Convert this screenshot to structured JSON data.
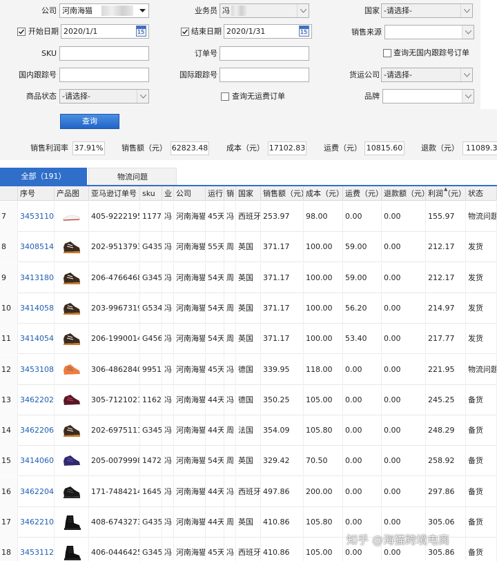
{
  "filters": {
    "company_label": "公司",
    "company_value": "河南海猫",
    "salesperson_label": "业务员",
    "salesperson_value": "冯",
    "country_label": "国家",
    "country_value": "-请选择-",
    "start_date_label": "开始日期",
    "start_date_value": "2020/1/1",
    "end_date_label": "结束日期",
    "end_date_value": "2020/1/31",
    "calendar_number": "15",
    "sales_source_label": "销售来源",
    "sales_source_value": "",
    "sku_label": "SKU",
    "sku_value": "",
    "order_no_label": "订单号",
    "order_no_value": "",
    "no_domestic_tracking_label": "查询无国内跟踪号订单",
    "domestic_tracking_label": "国内跟踪号",
    "domestic_tracking_value": "",
    "intl_tracking_label": "国际跟踪号",
    "intl_tracking_value": "",
    "freight_company_label": "货运公司",
    "freight_company_value": "-请选择-",
    "product_status_label": "商品状态",
    "product_status_value": "-请选择-",
    "no_freight_label": "查询无运费订单",
    "brand_label": "品牌",
    "brand_value": "",
    "query_button": "查询"
  },
  "stats": {
    "profit_rate_label": "销售利润率",
    "profit_rate_value": "37.91%",
    "sales_label": "销售额（元）",
    "sales_value": "62823.48",
    "cost_label": "成本（元）",
    "cost_value": "17102.83",
    "freight_label": "运费（元）",
    "freight_value": "10815.60",
    "refund_label": "退款（元）",
    "refund_value": "11089.39"
  },
  "tabs": [
    {
      "label": "全部（191）"
    },
    {
      "label": "物流问题"
    }
  ],
  "table": {
    "headers": [
      "序号",
      "产品图",
      "亚马逊订单号",
      "sku",
      "业",
      "公司",
      "运行",
      "销",
      "国家",
      "销售额（元）",
      "成本（元）",
      "运费（元）",
      "退款额（元）",
      "利润（元）",
      "状态"
    ],
    "rows": [
      {
        "row": "7",
        "no": "3453110",
        "shoe": "white",
        "order": "405-9222195-",
        "sku": "1177.",
        "biz": "冯",
        "company": "河南海猫",
        "run": "45天",
        "sales_ch": "冯",
        "country": "西班牙",
        "sales": "253.97",
        "cost": "98.00",
        "freight": "0.00",
        "refund": "0.00",
        "profit": "155.97",
        "status": "物流问题"
      },
      {
        "row": "8",
        "no": "3408514",
        "shoe": "brown",
        "order": "202-9513793-",
        "sku": "G435",
        "biz": "冯",
        "company": "河南海猫",
        "run": "55天",
        "sales_ch": "周",
        "country": "英国",
        "sales": "371.17",
        "cost": "100.00",
        "freight": "59.00",
        "refund": "0.00",
        "profit": "212.17",
        "status": "发货"
      },
      {
        "row": "9",
        "no": "3413180",
        "shoe": "brown",
        "order": "206-4766468-",
        "sku": "G345",
        "biz": "冯",
        "company": "河南海猫",
        "run": "54天",
        "sales_ch": "周",
        "country": "英国",
        "sales": "371.17",
        "cost": "100.00",
        "freight": "59.00",
        "refund": "0.00",
        "profit": "212.17",
        "status": "发货"
      },
      {
        "row": "10",
        "no": "3414058",
        "shoe": "brown",
        "order": "203-9967319-",
        "sku": "G534",
        "biz": "冯",
        "company": "河南海猫",
        "run": "54天",
        "sales_ch": "周",
        "country": "英国",
        "sales": "371.17",
        "cost": "100.00",
        "freight": "56.20",
        "refund": "0.00",
        "profit": "214.97",
        "status": "发货"
      },
      {
        "row": "11",
        "no": "3414054",
        "shoe": "brown",
        "order": "206-1990014-",
        "sku": "G456",
        "biz": "冯",
        "company": "河南海猫",
        "run": "54天",
        "sales_ch": "周",
        "country": "英国",
        "sales": "371.17",
        "cost": "100.00",
        "freight": "53.40",
        "refund": "0.00",
        "profit": "217.77",
        "status": "发货"
      },
      {
        "row": "12",
        "no": "3453108",
        "shoe": "orange",
        "order": "306-4862840-",
        "sku": "9951.",
        "biz": "冯",
        "company": "河南海猫",
        "run": "45天",
        "sales_ch": "冯",
        "country": "德国",
        "sales": "339.95",
        "cost": "118.00",
        "freight": "0.00",
        "refund": "0.00",
        "profit": "221.95",
        "status": "物流问题"
      },
      {
        "row": "13",
        "no": "3462202",
        "shoe": "maroon",
        "order": "305-7121021-",
        "sku": "1162.",
        "biz": "冯",
        "company": "河南海猫",
        "run": "44天",
        "sales_ch": "冯",
        "country": "德国",
        "sales": "350.25",
        "cost": "105.00",
        "freight": "0.00",
        "refund": "0.00",
        "profit": "245.25",
        "status": "备货"
      },
      {
        "row": "14",
        "no": "3462206",
        "shoe": "brown",
        "order": "202-6975111-",
        "sku": "G345",
        "biz": "冯",
        "company": "河南海猫",
        "run": "44天",
        "sales_ch": "周",
        "country": "法国",
        "sales": "354.09",
        "cost": "105.80",
        "freight": "0.00",
        "refund": "0.00",
        "profit": "248.29",
        "status": "备货"
      },
      {
        "row": "15",
        "no": "3414060",
        "shoe": "purple",
        "order": "205-0079998-",
        "sku": "1472",
        "biz": "冯",
        "company": "河南海猫",
        "run": "54天",
        "sales_ch": "周",
        "country": "英国",
        "sales": "329.42",
        "cost": "70.50",
        "freight": "0.00",
        "refund": "0.00",
        "profit": "258.92",
        "status": "备货"
      },
      {
        "row": "16",
        "no": "3462204",
        "shoe": "black",
        "order": "171-7484214-",
        "sku": "1645",
        "biz": "冯",
        "company": "河南海猫",
        "run": "44天",
        "sales_ch": "冯",
        "country": "西班牙",
        "sales": "497.86",
        "cost": "200.00",
        "freight": "0.00",
        "refund": "0.00",
        "profit": "297.86",
        "status": "备货"
      },
      {
        "row": "17",
        "no": "3462210",
        "shoe": "black-boot",
        "order": "408-6743273-",
        "sku": "G435",
        "biz": "冯",
        "company": "河南海猫",
        "run": "44天",
        "sales_ch": "周",
        "country": "英国",
        "sales": "410.86",
        "cost": "105.80",
        "freight": "0.00",
        "refund": "0.00",
        "profit": "305.06",
        "status": "备货"
      },
      {
        "row": "18",
        "no": "3453112",
        "shoe": "black-boot",
        "order": "406-0446425-",
        "sku": "G345",
        "biz": "冯",
        "company": "河南海猫",
        "run": "45天",
        "sales_ch": "冯",
        "country": "西班牙",
        "sales": "410.86",
        "cost": "105.00",
        "freight": "0.00",
        "refund": "0.00",
        "profit": "305.86",
        "status": "备货"
      }
    ]
  },
  "watermark": "知乎 @海猫跨境电商",
  "colors": {
    "accent": "#2f6fc9",
    "link": "#1e5fb4",
    "panel_bg": "#f4f4f4"
  }
}
